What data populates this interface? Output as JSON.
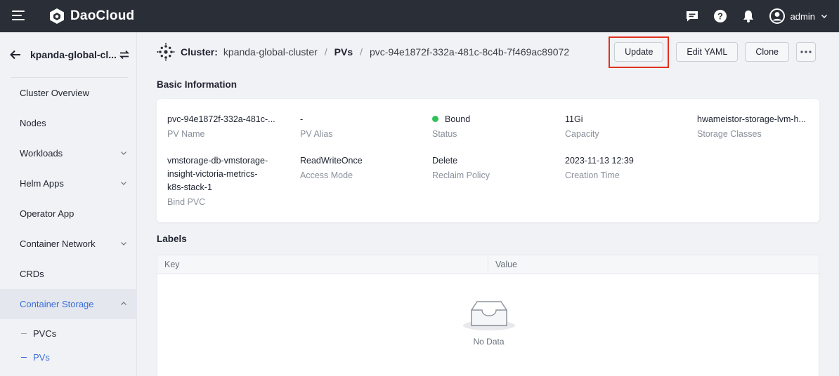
{
  "topbar": {
    "brand": "DaoCloud",
    "user": "admin",
    "icons": [
      "menu-icon",
      "daocloud-logo-icon",
      "message-icon",
      "help-icon",
      "bell-icon",
      "user-avatar-icon",
      "chevron-down-icon"
    ]
  },
  "sidebar": {
    "cluster": "kpanda-global-cl...",
    "items": [
      {
        "label": "Cluster Overview",
        "expandable": false
      },
      {
        "label": "Nodes",
        "expandable": false
      },
      {
        "label": "Workloads",
        "expandable": true
      },
      {
        "label": "Helm Apps",
        "expandable": true
      },
      {
        "label": "Operator App",
        "expandable": false
      },
      {
        "label": "Container Network",
        "expandable": true
      },
      {
        "label": "CRDs",
        "expandable": false
      },
      {
        "label": "Container Storage",
        "expandable": true,
        "expanded": true,
        "active": true
      }
    ],
    "subitems": [
      {
        "label": "PVCs",
        "active": false
      },
      {
        "label": "PVs",
        "active": true
      }
    ]
  },
  "breadcrumb": {
    "cluster_label": "Cluster:",
    "cluster": "kpanda-global-cluster",
    "sep1": "/",
    "section": "PVs",
    "sep2": "/",
    "current": "pvc-94e1872f-332a-481c-8c4b-7f469ac89072"
  },
  "actions": {
    "update": "Update",
    "edit_yaml": "Edit YAML",
    "clone": "Clone",
    "more": "•••"
  },
  "basic_info": {
    "title": "Basic Information",
    "row1": [
      {
        "value": "pvc-94e1872f-332a-481c-...",
        "label": "PV Name"
      },
      {
        "value": "-",
        "label": "PV Alias"
      },
      {
        "value": "Bound",
        "label": "Status"
      },
      {
        "value": "11Gi",
        "label": "Capacity"
      },
      {
        "value": "hwameistor-storage-lvm-h...",
        "label": "Storage Classes"
      }
    ],
    "row2": [
      {
        "value_lines": [
          "vmstorage-db-vmstorage-",
          "insight-victoria-metrics-",
          "k8s-stack-1"
        ],
        "label": "Bind PVC"
      },
      {
        "value": "ReadWriteOnce",
        "label": "Access Mode"
      },
      {
        "value": "Delete",
        "label": "Reclaim Policy"
      },
      {
        "value": "2023-11-13 12:39",
        "label": "Creation Time"
      }
    ],
    "status_color": "#2fc25b"
  },
  "labels": {
    "title": "Labels",
    "columns": [
      "Key",
      "Value"
    ],
    "empty_text": "No Data"
  },
  "colors": {
    "topbar": "#2a2e37",
    "accent": "#3a6fd8",
    "highlight": "#e0321f"
  }
}
